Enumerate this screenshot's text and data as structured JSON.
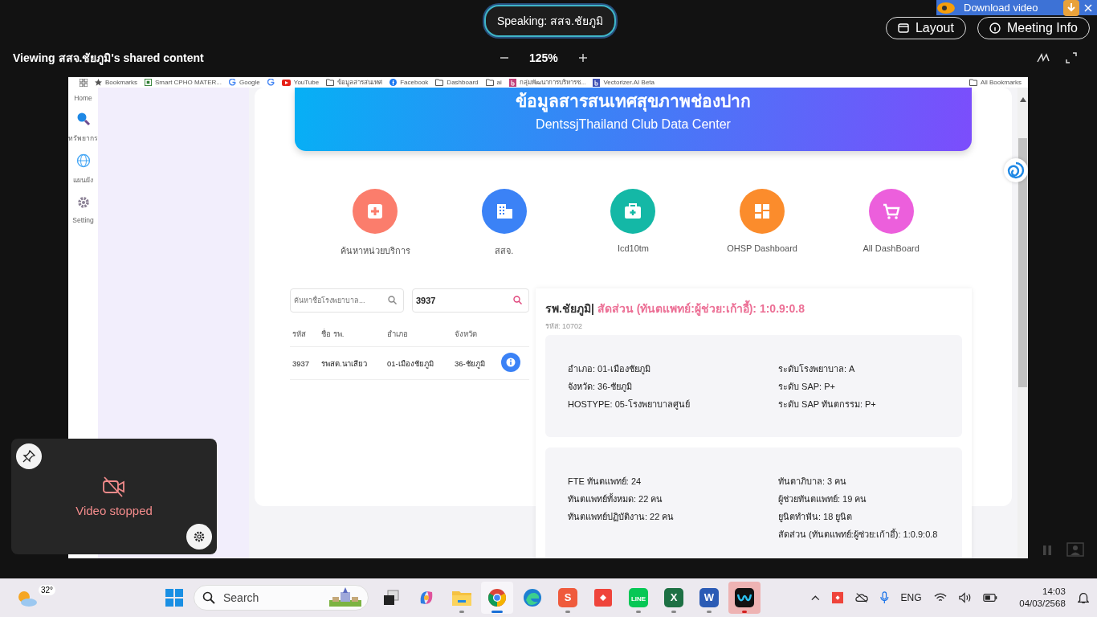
{
  "meeting": {
    "speaking": "Speaking: สสจ.ชัยภูมิ",
    "buttons": [
      {
        "label": "Layout",
        "kind": "layout"
      },
      {
        "label": "Meeting Info",
        "kind": "info"
      }
    ],
    "download_banner": "Download video",
    "viewing": "Viewing สสจ.ชัยภูมิ's shared content",
    "zoom": "125%"
  },
  "shared_screen": {
    "bookmarks": [
      {
        "kind": "star",
        "label": "Bookmarks"
      },
      {
        "kind": "page",
        "label": "Smart CPHO MATER..."
      },
      {
        "kind": "google",
        "label": "Google"
      },
      {
        "kind": "google"
      },
      {
        "kind": "youtube",
        "label": "YouTube"
      },
      {
        "kind": "folder",
        "label": "ข้อมูลสารสนเทศ"
      },
      {
        "kind": "facebook",
        "label": "Facebook"
      },
      {
        "kind": "folder",
        "label": "Dashboard"
      },
      {
        "kind": "folder",
        "label": "ai"
      },
      {
        "kind": "letter",
        "label": "กลุ่มพัฒนาการบริหารช..."
      },
      {
        "kind": "letter-blue",
        "label": "Vectorizer.AI Beta"
      }
    ],
    "all_bookmarks": "All Bookmarks",
    "rail": [
      {
        "kind": "none",
        "label": "Home"
      },
      {
        "kind": "search",
        "label": "ทรัพยากร"
      },
      {
        "kind": "globe",
        "label": "แผนผัง"
      },
      {
        "kind": "gear",
        "label": "Setting"
      }
    ],
    "banner": {
      "title": "ข้อมูลสารสนเทศสุขภาพช่องปาก",
      "subtitle": "DentssjThailand Club Data Center"
    },
    "shortcuts": [
      {
        "kind": "plus",
        "label": "ค้นหาหน่วยบริการ",
        "color": "#fb7d6c"
      },
      {
        "kind": "building",
        "label": "สสจ.",
        "color": "#3b82f6"
      },
      {
        "kind": "kit",
        "label": "Icd10tm",
        "color": "#14b8a6"
      },
      {
        "kind": "grid",
        "label": "OHSP Dashboard",
        "color": "#fb8c2c"
      },
      {
        "kind": "cart",
        "label": "All DashBoard",
        "color": "#ec5fdc"
      }
    ],
    "search_fields": [
      {
        "placeholder": "ค้นหาชื่อโรงพยาบาล..."
      },
      {
        "value": "3937"
      }
    ],
    "table": {
      "columns": [
        "รหัส",
        "ชื่อ รพ.",
        "อำเภอ",
        "จังหวัด"
      ],
      "rows": [
        [
          "3937",
          "รพสต.นาเสียว",
          "01-เมืองชัยภูมิ",
          "36-ชัยภูมิ"
        ]
      ]
    },
    "detail": {
      "name": "รพ.ชัยภูมิ|",
      "ratio": "สัดส่วน (ทันตแพทย์:ผู้ช่วย:เก้าอี้): 1:0.9:0.8",
      "code": "รหัส: 10702",
      "info": [
        [
          "อำเภอ: 01-เมืองชัยภูมิ",
          "จังหวัด: 36-ชัยภูมิ",
          "HOSTYPE: 05-โรงพยาบาลศูนย์"
        ],
        [
          "ระดับโรงพยาบาล: A",
          "ระดับ SAP: P+",
          "ระดับ SAP ทันตกรรม: P+"
        ]
      ],
      "staff": [
        [
          "FTE ทันตแพทย์: 24",
          "ทันตแพทย์ทั้งหมด: 22 คน",
          "ทันตแพทย์ปฏิบัติงาน: 22 คน"
        ],
        [
          "ทันตาภิบาล: 3 คน",
          "ผู้ช่วยทันตแพทย์: 19 คน",
          "ยูนิตทำฟัน: 18 ยูนิต",
          "สัดส่วน (ทันตแพทย์:ผู้ช่วย:เก้าอี้): 1:0.9:0.8"
        ]
      ]
    }
  },
  "video_tile": {
    "status": "Video stopped"
  },
  "taskbar": {
    "weather": "32°",
    "search": "Search",
    "apps": [
      {
        "kind": "windows",
        "running": false,
        "selected": false,
        "flashing": false
      },
      {
        "kind": "taskview",
        "running": false,
        "selected": false,
        "flashing": false
      },
      {
        "kind": "copilot",
        "running": false,
        "selected": false,
        "flashing": false
      },
      {
        "kind": "folder",
        "running": true,
        "selected": false,
        "flashing": false
      },
      {
        "kind": "chrome",
        "running": true,
        "selected": true,
        "flashing": false
      },
      {
        "kind": "edge",
        "running": false,
        "selected": false,
        "flashing": false
      },
      {
        "kind": "s-app",
        "letter": "S",
        "running": true,
        "selected": false,
        "flashing": false
      },
      {
        "kind": "diamond",
        "running": false,
        "selected": false,
        "flashing": false
      },
      {
        "kind": "line",
        "letter": "LINE",
        "running": true,
        "selected": false,
        "flashing": false
      },
      {
        "kind": "excel",
        "letter": "X",
        "running": true,
        "selected": false,
        "flashing": false
      },
      {
        "kind": "word",
        "letter": "W",
        "running": true,
        "selected": false,
        "flashing": false
      },
      {
        "kind": "webex",
        "running": true,
        "selected": false,
        "flashing": true
      }
    ],
    "language": "ENG",
    "time": "14:03",
    "date": "04/03/2568"
  }
}
